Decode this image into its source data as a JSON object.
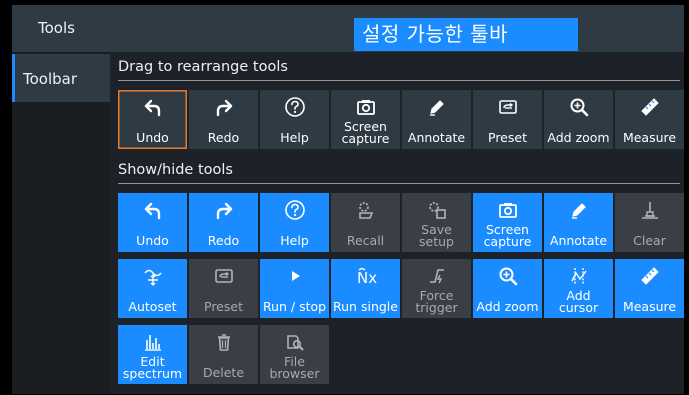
{
  "header": {
    "title": "Tools",
    "caption": "설정 가능한 툴바"
  },
  "sidebar": {
    "items": [
      {
        "label": "Toolbar",
        "active": true
      }
    ]
  },
  "toolbar_section": {
    "title": "Drag to rearrange tools",
    "items": [
      {
        "label": "Undo",
        "icon": "undo-icon",
        "selected": true
      },
      {
        "label": "Redo",
        "icon": "redo-icon"
      },
      {
        "label": "Help",
        "icon": "help-icon"
      },
      {
        "label": "Screen\ncapture",
        "icon": "camera-icon"
      },
      {
        "label": "Annotate",
        "icon": "pen-icon"
      },
      {
        "label": "Preset",
        "icon": "preset-icon"
      },
      {
        "label": "Add zoom",
        "icon": "zoom-icon"
      },
      {
        "label": "Measure",
        "icon": "ruler-icon"
      }
    ]
  },
  "tools_section": {
    "title": "Show/hide tools",
    "items": [
      {
        "label": "Undo",
        "icon": "undo-icon",
        "enabled": true
      },
      {
        "label": "Redo",
        "icon": "redo-icon",
        "enabled": true
      },
      {
        "label": "Help",
        "icon": "help-icon",
        "enabled": true
      },
      {
        "label": "Recall",
        "icon": "recall-icon",
        "enabled": false
      },
      {
        "label": "Save\nsetup",
        "icon": "save-setup-icon",
        "enabled": false
      },
      {
        "label": "Screen\ncapture",
        "icon": "camera-icon",
        "enabled": true
      },
      {
        "label": "Annotate",
        "icon": "pen-icon",
        "enabled": true
      },
      {
        "label": "Clear",
        "icon": "clear-icon",
        "enabled": false
      },
      {
        "label": "Autoset",
        "icon": "autoset-icon",
        "enabled": true
      },
      {
        "label": "Preset",
        "icon": "preset-icon",
        "enabled": false
      },
      {
        "label": "Run / stop",
        "icon": "play-icon",
        "enabled": true
      },
      {
        "label": "Run single",
        "icon": "run-single-icon",
        "enabled": true
      },
      {
        "label": "Force\ntrigger",
        "icon": "force-trigger-icon",
        "enabled": false
      },
      {
        "label": "Add zoom",
        "icon": "zoom-icon",
        "enabled": true
      },
      {
        "label": "Add\ncursor",
        "icon": "cursor-icon",
        "enabled": true
      },
      {
        "label": "Measure",
        "icon": "ruler-icon",
        "enabled": true
      },
      {
        "label": "Edit\nspectrum",
        "icon": "spectrum-icon",
        "enabled": true
      },
      {
        "label": "Delete",
        "icon": "trash-icon",
        "enabled": false
      },
      {
        "label": "File\nbrowser",
        "icon": "file-browser-icon",
        "enabled": false
      }
    ]
  },
  "colors": {
    "accent": "#1a8cff",
    "selection": "#e8792a",
    "tile": "#2e3a44",
    "tile_off": "#3a3f45",
    "panel": "#1d2228"
  }
}
